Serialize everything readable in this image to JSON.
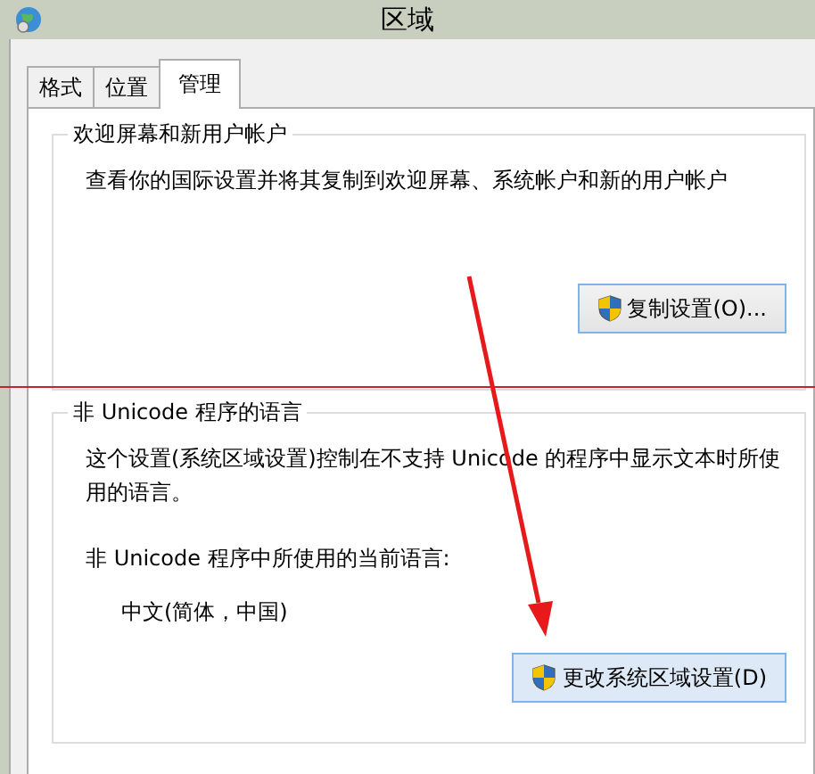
{
  "window": {
    "title": "区域"
  },
  "tabs": [
    {
      "label": "格式",
      "selected": false
    },
    {
      "label": "位置",
      "selected": false
    },
    {
      "label": "管理",
      "selected": true
    }
  ],
  "groups": [
    {
      "title": "欢迎屏幕和新用户帐户",
      "items": [
        {
          "kind": "description",
          "text": "查看你的国际设置并将其复制到欢迎屏幕、系统帐户和新的用户帐户"
        },
        {
          "kind": "button",
          "text": "复制设置(O)..."
        }
      ]
    },
    {
      "title": "非 Unicode 程序的语言",
      "items": [
        {
          "kind": "description",
          "text": "这个设置(系统区域设置)控制在不支持 Unicode 的程序中显示文本时所使用的语言。"
        },
        {
          "kind": "label",
          "text": "非 Unicode 程序中所使用的当前语言:"
        },
        {
          "kind": "value",
          "text": "中文(简体，中国)"
        },
        {
          "kind": "button",
          "text": "更改系统区域设置(D)"
        }
      ]
    }
  ]
}
